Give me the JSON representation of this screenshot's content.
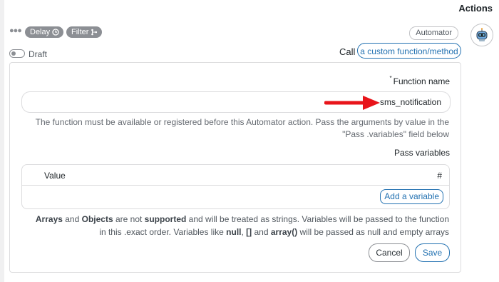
{
  "sidebar": {
    "title": "Actions"
  },
  "step": {
    "delay_label": "Delay",
    "filter_label": "Filter",
    "badge": "Automator",
    "draft_label": "Draft",
    "call_label": "Call",
    "call_button": "a custom function/method",
    "icons": [
      "more-dots-icon",
      "clock-icon",
      "branch-icon",
      "robot-icon"
    ]
  },
  "form": {
    "function_name_label": "Function name",
    "function_name_marker": "*",
    "function_name_value": "sms_notification",
    "function_help": "The function must be available or registered before this Automator action. Pass the arguments by value in the \"Pass .variables\" field below",
    "pass_variables_label": "Pass variables",
    "table": {
      "columns": [
        "Value",
        "#"
      ]
    },
    "add_variable_button": "Add a variable",
    "variables_help": {
      "w1": "Arrays",
      "t1": " and ",
      "w2": "Objects",
      "t2": " are not ",
      "w3": "supported",
      "t3": " and will be treated as strings. Variables will be passed to the function in this .exact order. Variables like ",
      "w4": "null",
      "t4": ", ",
      "w5": "[]",
      "t5": " and ",
      "w6": "array()",
      "t6": " will be passed as null and empty arrays"
    },
    "cancel_button": "Cancel",
    "save_button": "Save"
  },
  "colors": {
    "accent": "#2271b1",
    "pill_gray": "#8c8f94",
    "arrow": "#e8141a",
    "border": "#dcdcde"
  }
}
